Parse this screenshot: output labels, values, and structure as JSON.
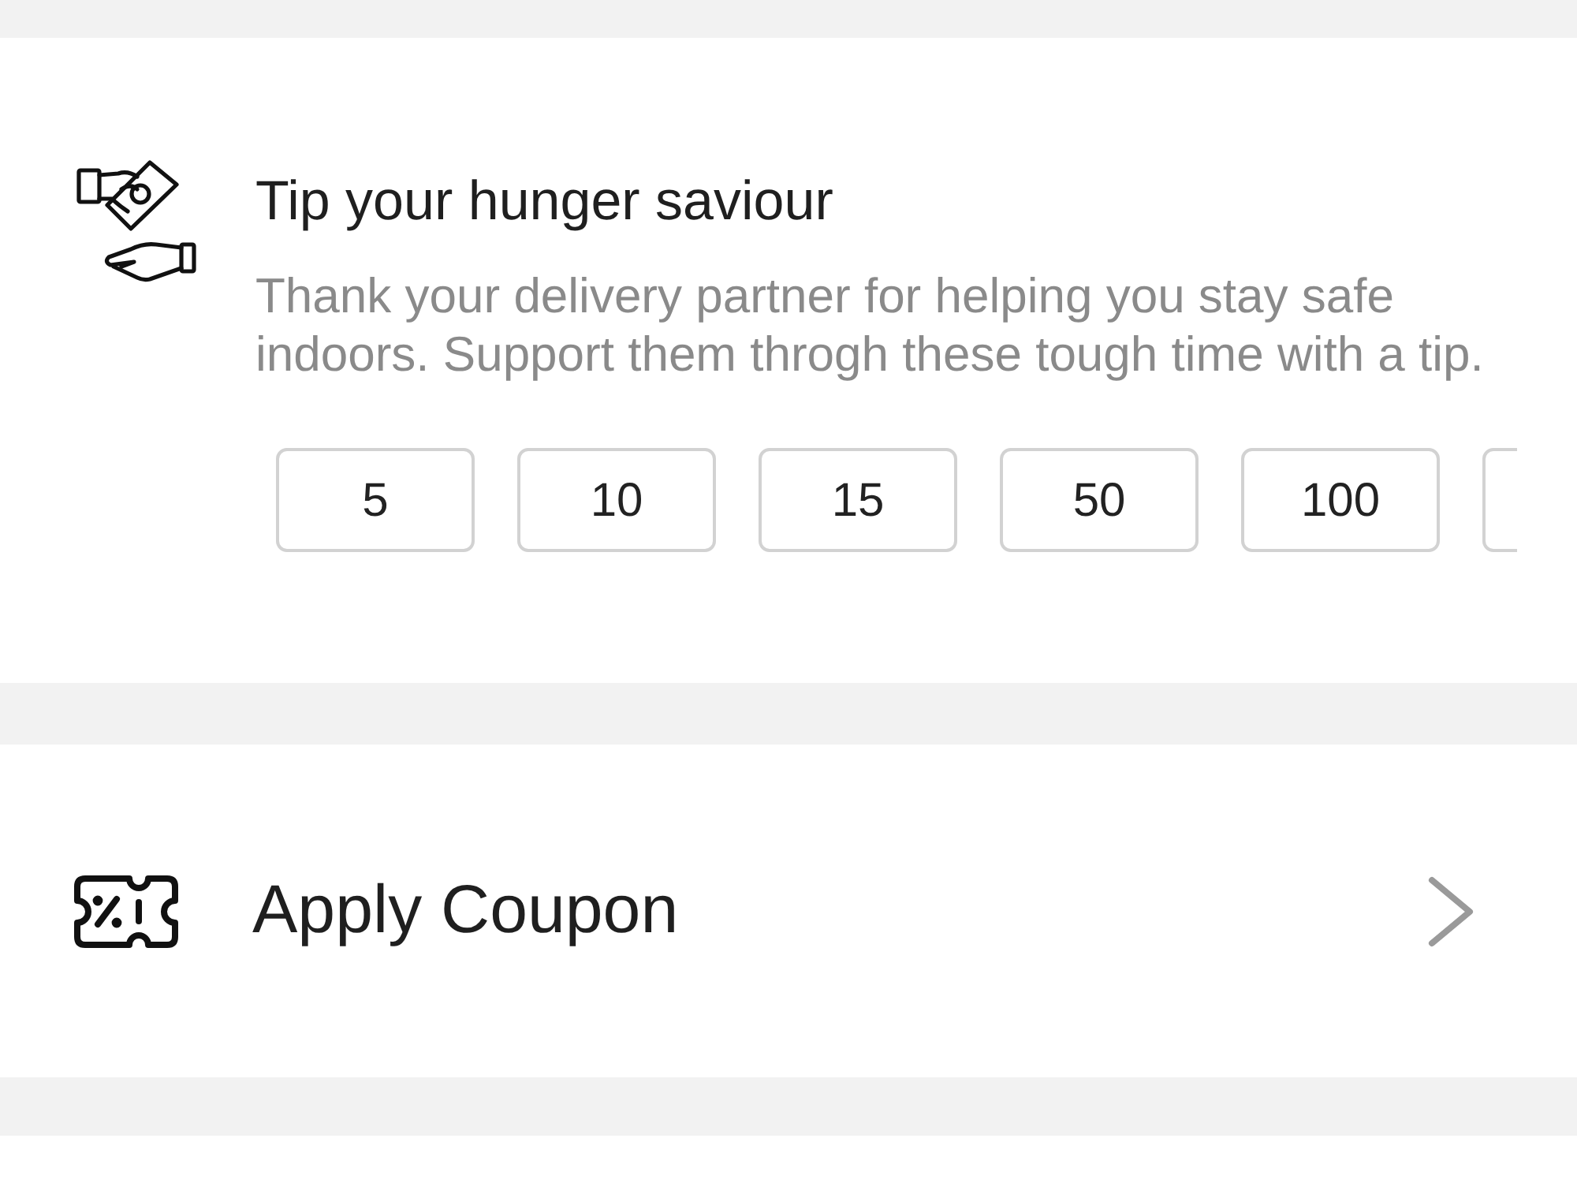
{
  "tip_section": {
    "title": "Tip your hunger saviour",
    "description": "Thank your delivery partner for helping you stay safe indoors. Support them throgh these tough time with a tip.",
    "tip_options": [
      {
        "kind": "amount",
        "amount": "5"
      },
      {
        "kind": "amount",
        "amount": "10"
      },
      {
        "kind": "amount",
        "amount": "15"
      },
      {
        "kind": "amount",
        "amount": "50"
      },
      {
        "kind": "amount",
        "amount": "100"
      },
      {
        "kind": "partial"
      }
    ]
  },
  "coupon_row": {
    "label": "Apply Coupon"
  }
}
